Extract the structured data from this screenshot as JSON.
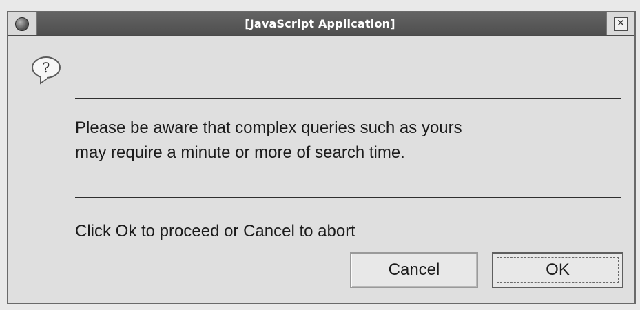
{
  "window": {
    "title": "[JavaScript Application]",
    "close_glyph": "✕"
  },
  "dialog": {
    "icon": "question-balloon-icon",
    "icon_glyph": "?",
    "message_line1": "Please be aware that complex queries such as yours",
    "message_line2": "may require a minute or more of search time.",
    "prompt": "Click Ok to proceed or Cancel to abort"
  },
  "buttons": {
    "cancel_label": "Cancel",
    "ok_label": "OK",
    "default": "OK"
  }
}
